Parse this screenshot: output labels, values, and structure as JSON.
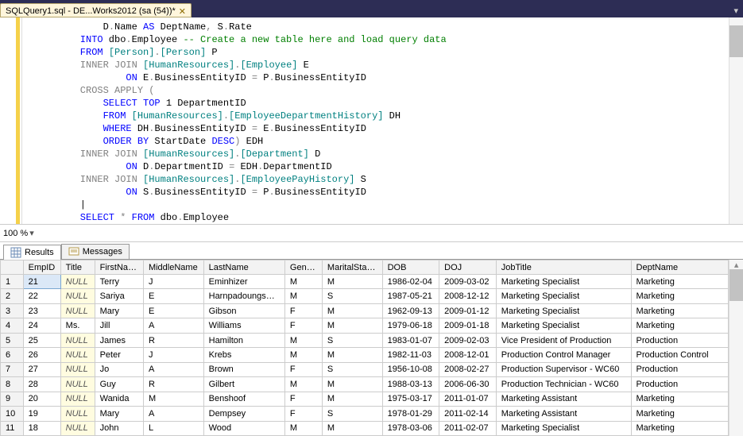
{
  "tab": {
    "title": "SQLQuery1.sql - DE...Works2012 (sa (54))*",
    "close": "✕"
  },
  "topright_arrow": "▾",
  "code": {
    "lines": [
      [
        {
          "c": "plain",
          "t": "        D"
        },
        {
          "c": "gray",
          "t": "."
        },
        {
          "c": "plain",
          "t": "Name "
        },
        {
          "c": "kw",
          "t": "AS"
        },
        {
          "c": "plain",
          "t": " DeptName"
        },
        {
          "c": "gray",
          "t": ","
        },
        {
          "c": "plain",
          "t": " S"
        },
        {
          "c": "gray",
          "t": "."
        },
        {
          "c": "plain",
          "t": "Rate"
        }
      ],
      [
        {
          "c": "kw",
          "t": "    INTO"
        },
        {
          "c": "plain",
          "t": " dbo"
        },
        {
          "c": "gray",
          "t": "."
        },
        {
          "c": "plain",
          "t": "Employee "
        },
        {
          "c": "comm",
          "t": "-- Create a new table here and load query data"
        }
      ],
      [
        {
          "c": "kw",
          "t": "    FROM "
        },
        {
          "c": "ident",
          "t": "[Person]"
        },
        {
          "c": "gray",
          "t": "."
        },
        {
          "c": "ident",
          "t": "[Person]"
        },
        {
          "c": "plain",
          "t": " P"
        }
      ],
      [
        {
          "c": "gray",
          "t": "    INNER JOIN "
        },
        {
          "c": "ident",
          "t": "[HumanResources]"
        },
        {
          "c": "gray",
          "t": "."
        },
        {
          "c": "ident",
          "t": "[Employee]"
        },
        {
          "c": "plain",
          "t": " E"
        }
      ],
      [
        {
          "c": "kw",
          "t": "            ON"
        },
        {
          "c": "plain",
          "t": " E"
        },
        {
          "c": "gray",
          "t": "."
        },
        {
          "c": "plain",
          "t": "BusinessEntityID "
        },
        {
          "c": "gray",
          "t": "="
        },
        {
          "c": "plain",
          "t": " P"
        },
        {
          "c": "gray",
          "t": "."
        },
        {
          "c": "plain",
          "t": "BusinessEntityID"
        }
      ],
      [
        {
          "c": "gray",
          "t": "    CROSS APPLY ("
        }
      ],
      [
        {
          "c": "kw",
          "t": "        SELECT TOP"
        },
        {
          "c": "plain",
          "t": " 1 DepartmentID"
        }
      ],
      [
        {
          "c": "kw",
          "t": "        FROM "
        },
        {
          "c": "ident",
          "t": "[HumanResources]"
        },
        {
          "c": "gray",
          "t": "."
        },
        {
          "c": "ident",
          "t": "[EmployeeDepartmentHistory]"
        },
        {
          "c": "plain",
          "t": " DH"
        }
      ],
      [
        {
          "c": "kw",
          "t": "        WHERE"
        },
        {
          "c": "plain",
          "t": " DH"
        },
        {
          "c": "gray",
          "t": "."
        },
        {
          "c": "plain",
          "t": "BusinessEntityID "
        },
        {
          "c": "gray",
          "t": "="
        },
        {
          "c": "plain",
          "t": " E"
        },
        {
          "c": "gray",
          "t": "."
        },
        {
          "c": "plain",
          "t": "BusinessEntityID"
        }
      ],
      [
        {
          "c": "kw",
          "t": "        ORDER BY"
        },
        {
          "c": "plain",
          "t": " StartDate "
        },
        {
          "c": "kw",
          "t": "DESC"
        },
        {
          "c": "gray",
          "t": ")"
        },
        {
          "c": "plain",
          "t": " EDH"
        }
      ],
      [
        {
          "c": "gray",
          "t": "    INNER JOIN "
        },
        {
          "c": "ident",
          "t": "[HumanResources]"
        },
        {
          "c": "gray",
          "t": "."
        },
        {
          "c": "ident",
          "t": "[Department]"
        },
        {
          "c": "plain",
          "t": " D"
        }
      ],
      [
        {
          "c": "kw",
          "t": "            ON"
        },
        {
          "c": "plain",
          "t": " D"
        },
        {
          "c": "gray",
          "t": "."
        },
        {
          "c": "plain",
          "t": "DepartmentID "
        },
        {
          "c": "gray",
          "t": "="
        },
        {
          "c": "plain",
          "t": " EDH"
        },
        {
          "c": "gray",
          "t": "."
        },
        {
          "c": "plain",
          "t": "DepartmentID"
        }
      ],
      [
        {
          "c": "gray",
          "t": "    INNER JOIN "
        },
        {
          "c": "ident",
          "t": "[HumanResources]"
        },
        {
          "c": "gray",
          "t": "."
        },
        {
          "c": "ident",
          "t": "[EmployeePayHistory]"
        },
        {
          "c": "plain",
          "t": " S"
        }
      ],
      [
        {
          "c": "kw",
          "t": "            ON"
        },
        {
          "c": "plain",
          "t": " S"
        },
        {
          "c": "gray",
          "t": "."
        },
        {
          "c": "plain",
          "t": "BusinessEntityID "
        },
        {
          "c": "gray",
          "t": "="
        },
        {
          "c": "plain",
          "t": " P"
        },
        {
          "c": "gray",
          "t": "."
        },
        {
          "c": "plain",
          "t": "BusinessEntityID"
        }
      ],
      [
        {
          "c": "cursor-line",
          "t": "    |"
        }
      ],
      [
        {
          "c": "kw",
          "t": "    SELECT "
        },
        {
          "c": "gray",
          "t": "*"
        },
        {
          "c": "kw",
          "t": " FROM"
        },
        {
          "c": "plain",
          "t": " dbo"
        },
        {
          "c": "gray",
          "t": "."
        },
        {
          "c": "plain",
          "t": "Employee"
        }
      ]
    ]
  },
  "status": {
    "zoom": "100 %",
    "drop": "▾"
  },
  "results_tabs": {
    "results": "Results",
    "messages": "Messages"
  },
  "grid": {
    "columns": [
      "EmpID",
      "Title",
      "FirstName",
      "MiddleName",
      "LastName",
      "Gender",
      "MaritalStatus",
      "DOB",
      "DOJ",
      "JobTitle",
      "DeptName"
    ],
    "widths": [
      46,
      42,
      60,
      74,
      100,
      46,
      74,
      70,
      70,
      166,
      120
    ],
    "rows": [
      {
        "n": "1",
        "EmpID": "21",
        "Title": "NULL",
        "FirstName": "Terry",
        "MiddleName": "J",
        "LastName": "Eminhizer",
        "Gender": "M",
        "MaritalStatus": "M",
        "DOB": "1986-02-04",
        "DOJ": "2009-03-02",
        "JobTitle": "Marketing Specialist",
        "DeptName": "Marketing"
      },
      {
        "n": "2",
        "EmpID": "22",
        "Title": "NULL",
        "FirstName": "Sariya",
        "MiddleName": "E",
        "LastName": "Harnpadoungsataya",
        "Gender": "M",
        "MaritalStatus": "S",
        "DOB": "1987-05-21",
        "DOJ": "2008-12-12",
        "JobTitle": "Marketing Specialist",
        "DeptName": "Marketing"
      },
      {
        "n": "3",
        "EmpID": "23",
        "Title": "NULL",
        "FirstName": "Mary",
        "MiddleName": "E",
        "LastName": "Gibson",
        "Gender": "F",
        "MaritalStatus": "M",
        "DOB": "1962-09-13",
        "DOJ": "2009-01-12",
        "JobTitle": "Marketing Specialist",
        "DeptName": "Marketing"
      },
      {
        "n": "4",
        "EmpID": "24",
        "Title": "Ms.",
        "FirstName": "Jill",
        "MiddleName": "A",
        "LastName": "Williams",
        "Gender": "F",
        "MaritalStatus": "M",
        "DOB": "1979-06-18",
        "DOJ": "2009-01-18",
        "JobTitle": "Marketing Specialist",
        "DeptName": "Marketing"
      },
      {
        "n": "5",
        "EmpID": "25",
        "Title": "NULL",
        "FirstName": "James",
        "MiddleName": "R",
        "LastName": "Hamilton",
        "Gender": "M",
        "MaritalStatus": "S",
        "DOB": "1983-01-07",
        "DOJ": "2009-02-03",
        "JobTitle": "Vice President of Production",
        "DeptName": "Production"
      },
      {
        "n": "6",
        "EmpID": "26",
        "Title": "NULL",
        "FirstName": "Peter",
        "MiddleName": "J",
        "LastName": "Krebs",
        "Gender": "M",
        "MaritalStatus": "M",
        "DOB": "1982-11-03",
        "DOJ": "2008-12-01",
        "JobTitle": "Production Control Manager",
        "DeptName": "Production Control"
      },
      {
        "n": "7",
        "EmpID": "27",
        "Title": "NULL",
        "FirstName": "Jo",
        "MiddleName": "A",
        "LastName": "Brown",
        "Gender": "F",
        "MaritalStatus": "S",
        "DOB": "1956-10-08",
        "DOJ": "2008-02-27",
        "JobTitle": "Production Supervisor - WC60",
        "DeptName": "Production"
      },
      {
        "n": "8",
        "EmpID": "28",
        "Title": "NULL",
        "FirstName": "Guy",
        "MiddleName": "R",
        "LastName": "Gilbert",
        "Gender": "M",
        "MaritalStatus": "M",
        "DOB": "1988-03-13",
        "DOJ": "2006-06-30",
        "JobTitle": "Production Technician - WC60",
        "DeptName": "Production"
      },
      {
        "n": "9",
        "EmpID": "20",
        "Title": "NULL",
        "FirstName": "Wanida",
        "MiddleName": "M",
        "LastName": "Benshoof",
        "Gender": "F",
        "MaritalStatus": "M",
        "DOB": "1975-03-17",
        "DOJ": "2011-01-07",
        "JobTitle": "Marketing Assistant",
        "DeptName": "Marketing"
      },
      {
        "n": "10",
        "EmpID": "19",
        "Title": "NULL",
        "FirstName": "Mary",
        "MiddleName": "A",
        "LastName": "Dempsey",
        "Gender": "F",
        "MaritalStatus": "S",
        "DOB": "1978-01-29",
        "DOJ": "2011-02-14",
        "JobTitle": "Marketing Assistant",
        "DeptName": "Marketing"
      },
      {
        "n": "11",
        "EmpID": "18",
        "Title": "NULL",
        "FirstName": "John",
        "MiddleName": "L",
        "LastName": "Wood",
        "Gender": "M",
        "MaritalStatus": "M",
        "DOB": "1978-03-06",
        "DOJ": "2011-02-07",
        "JobTitle": "Marketing Specialist",
        "DeptName": "Marketing"
      }
    ],
    "selected": {
      "row": 0,
      "col": "EmpID"
    }
  }
}
